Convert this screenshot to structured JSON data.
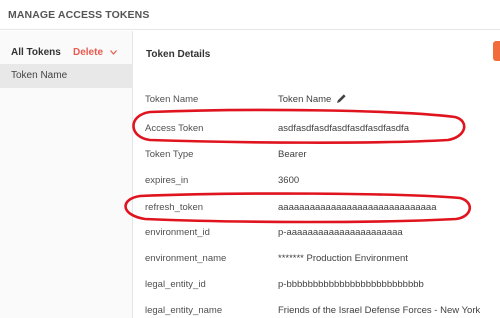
{
  "header": {
    "title": "MANAGE ACCESS TOKENS"
  },
  "sidebar": {
    "all_tokens_label": "All Tokens",
    "delete_label": "Delete",
    "items": [
      {
        "label": "Token Name"
      }
    ]
  },
  "details": {
    "title": "Token Details",
    "rows": [
      {
        "key": "Token Name",
        "value": "Token Name"
      },
      {
        "key": "Access Token",
        "value": "asdfasdfasdfasdfasdfasdfasdfa"
      },
      {
        "key": "Token Type",
        "value": "Bearer"
      },
      {
        "key": "expires_in",
        "value": "3600"
      },
      {
        "key": "refresh_token",
        "value": "aaaaaaaaaaaaaaaaaaaaaaaaaaaaaa"
      },
      {
        "key": "environment_id",
        "value": "p-aaaaaaaaaaaaaaaaaaaaaa"
      },
      {
        "key": "environment_name",
        "value": "******* Production Environment"
      },
      {
        "key": "legal_entity_id",
        "value": "p-bbbbbbbbbbbbbbbbbbbbbbbbbb"
      },
      {
        "key": "legal_entity_name",
        "value": "Friends of the Israel Defense Forces - New York"
      }
    ]
  },
  "icons": {
    "edit": "pencil-icon",
    "delete_dropdown": "chevron-down-icon"
  },
  "colors": {
    "accent": "#f26b3a",
    "delete": "#e85a4f",
    "annotation": "#e0141e",
    "selected_item_bg": "#e8e8e8"
  }
}
